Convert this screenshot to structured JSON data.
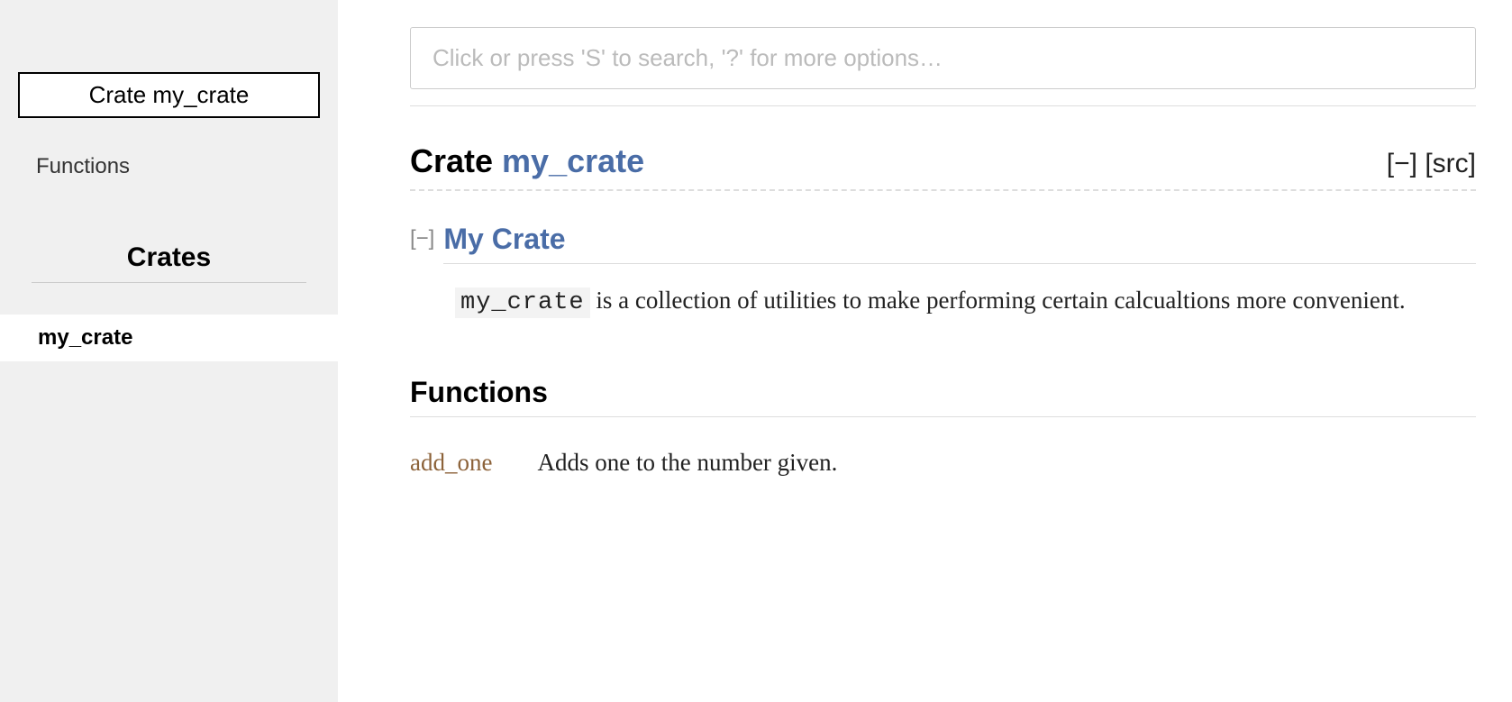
{
  "sidebar": {
    "crate_label": "Crate my_crate",
    "functions_link": "Functions",
    "crates_heading": "Crates",
    "crate_item": "my_crate"
  },
  "search": {
    "placeholder": "Click or press 'S' to search, '?' for more options…"
  },
  "page": {
    "title_prefix": "Crate ",
    "title_crate": "my_crate",
    "collapse_all": "[−]",
    "src_link": "[src]"
  },
  "doc": {
    "toggle": "[−]",
    "heading": "My Crate",
    "code": "my_crate",
    "body_rest": " is a collection of utilities to make performing certain calcualtions more convenient."
  },
  "functions": {
    "heading": "Functions",
    "items": [
      {
        "name": "add_one",
        "desc": "Adds one to the number given."
      }
    ]
  }
}
